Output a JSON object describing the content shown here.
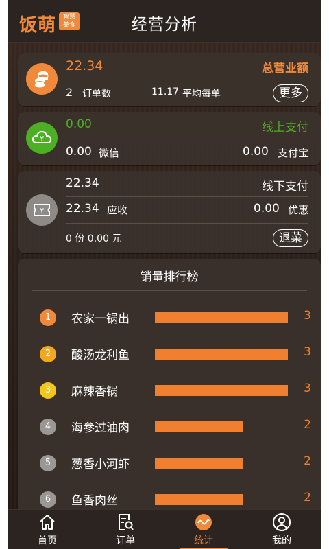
{
  "header": {
    "logo_text": "饭萌",
    "logo_badge_line1": "智慧",
    "logo_badge_line2": "美食",
    "title": "经营分析"
  },
  "revenue": {
    "amount": "22.34",
    "label": "总营业额",
    "order_count": "2",
    "order_count_label": "订单数",
    "avg_value": "11.17",
    "avg_label": "平均每单",
    "more_button": "更多"
  },
  "online": {
    "amount": "0.00",
    "label": "线上支付",
    "wechat_value": "0.00",
    "wechat_label": "微信",
    "alipay_value": "0.00",
    "alipay_label": "支付宝"
  },
  "offline": {
    "amount": "22.34",
    "label": "线下支付",
    "receivable_value": "22.34",
    "receivable_label": "应收",
    "discount_value": "0.00",
    "discount_label": "优惠",
    "refund_summary": "0 份 0.00 元",
    "refund_button": "退菜"
  },
  "ranking": {
    "title": "销量排行榜",
    "max": 3,
    "items": [
      {
        "rank": "1",
        "name": "农家一锅出",
        "value": 3,
        "value_label": "3",
        "badge_color": "#f08a3a"
      },
      {
        "rank": "2",
        "name": "酸汤龙利鱼",
        "value": 3,
        "value_label": "3",
        "badge_color": "#f2a71e"
      },
      {
        "rank": "3",
        "name": "麻辣香锅",
        "value": 3,
        "value_label": "3",
        "badge_color": "#f3c51d"
      },
      {
        "rank": "4",
        "name": "海参过油肉",
        "value": 2,
        "value_label": "2",
        "badge_color": "#9a9795"
      },
      {
        "rank": "5",
        "name": "葱香小河虾",
        "value": 2,
        "value_label": "2",
        "badge_color": "#9a9795"
      },
      {
        "rank": "6",
        "name": "鱼香肉丝",
        "value": 2,
        "value_label": "2",
        "badge_color": "#9a9795"
      }
    ]
  },
  "tabs": [
    {
      "label": "首页",
      "icon": "home-icon"
    },
    {
      "label": "订单",
      "icon": "order-search-icon"
    },
    {
      "label": "统计",
      "icon": "stats-wave-icon"
    },
    {
      "label": "我的",
      "icon": "user-icon"
    }
  ],
  "colors": {
    "accent": "#f08a3a",
    "online_green": "#4caf24",
    "offline_gray": "#8e8a87",
    "revenue_orange": "#f08a3a"
  }
}
